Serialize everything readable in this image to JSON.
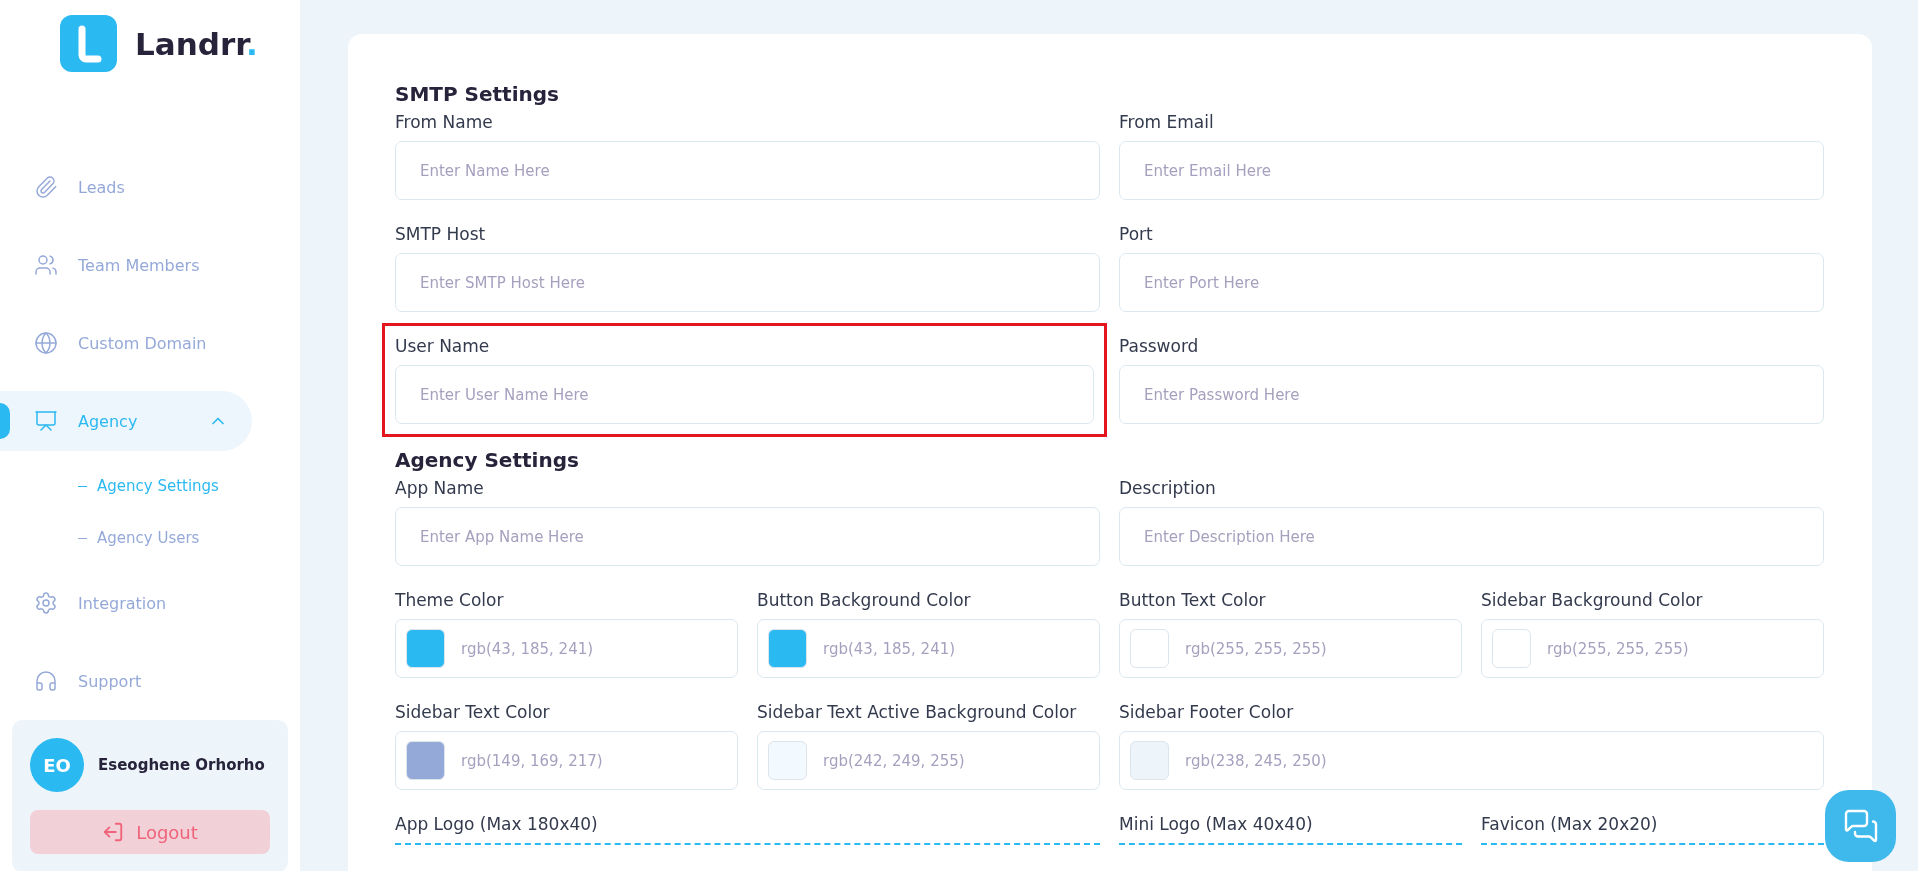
{
  "sidebar": {
    "brand": {
      "name": "Landrr",
      "dot": "."
    },
    "nav": [
      {
        "label": "Leads",
        "selected": false
      },
      {
        "label": "Team Members",
        "selected": false
      },
      {
        "label": "Custom Domain",
        "selected": false
      },
      {
        "label": "Agency",
        "selected": true,
        "expanded": true,
        "children": [
          {
            "label": "Agency Settings",
            "selected": true
          },
          {
            "label": "Agency Users",
            "selected": false
          }
        ]
      },
      {
        "label": "Integration",
        "selected": false
      },
      {
        "label": "Support",
        "selected": false
      }
    ],
    "user": {
      "initials": "EO",
      "name": "Eseoghene Orhorho"
    },
    "logout": "Logout"
  },
  "sections": [
    {
      "title": "SMTP Settings",
      "fields": [
        {
          "label": "From Name",
          "placeholder": "Enter Name Here",
          "highlighted": false
        },
        {
          "label": "From Email",
          "placeholder": "Enter Email Here",
          "highlighted": false
        },
        {
          "label": "SMTP Host",
          "placeholder": "Enter SMTP Host Here",
          "highlighted": false
        },
        {
          "label": "Port",
          "placeholder": "Enter Port Here",
          "highlighted": false
        },
        {
          "label": "User Name",
          "placeholder": "Enter User Name Here",
          "highlighted": true
        },
        {
          "label": "Password",
          "placeholder": "Enter Password Here",
          "highlighted": false
        }
      ]
    },
    {
      "title": "Agency Settings",
      "fields": [
        {
          "label": "App Name",
          "placeholder": "Enter App Name Here",
          "highlighted": false
        },
        {
          "label": "Description",
          "placeholder": "Enter Description Here",
          "highlighted": false
        }
      ],
      "color_fields": [
        {
          "label": "Theme Color",
          "value": "rgb(43, 185, 241)",
          "color": "#2bb9f1",
          "wide": false
        },
        {
          "label": "Button Background Color",
          "value": "rgb(43, 185, 241)",
          "color": "#2bb9f1",
          "wide": false
        },
        {
          "label": "Button Text Color",
          "value": "rgb(255, 255, 255)",
          "color": "#ffffff",
          "wide": false
        },
        {
          "label": "Sidebar Background Color",
          "value": "rgb(255, 255, 255)",
          "color": "#ffffff",
          "wide": false
        },
        {
          "label": "Sidebar Text Color",
          "value": "rgb(149, 169, 217)",
          "color": "#95a9d9",
          "wide": false
        },
        {
          "label": "Sidebar Text Active Background Color",
          "value": "rgb(242, 249, 255)",
          "color": "#f2f9ff",
          "wide": false
        },
        {
          "label": "Sidebar Footer Color",
          "value": "rgb(238, 245, 250)",
          "color": "#eef5fa",
          "wide": true
        }
      ],
      "uploads": [
        {
          "label": "App Logo (Max 180x40)",
          "wide": true
        },
        {
          "label": "Mini Logo (Max 40x40)",
          "wide": false
        },
        {
          "label": "Favicon (Max 20x20)",
          "wide": false
        }
      ]
    }
  ]
}
